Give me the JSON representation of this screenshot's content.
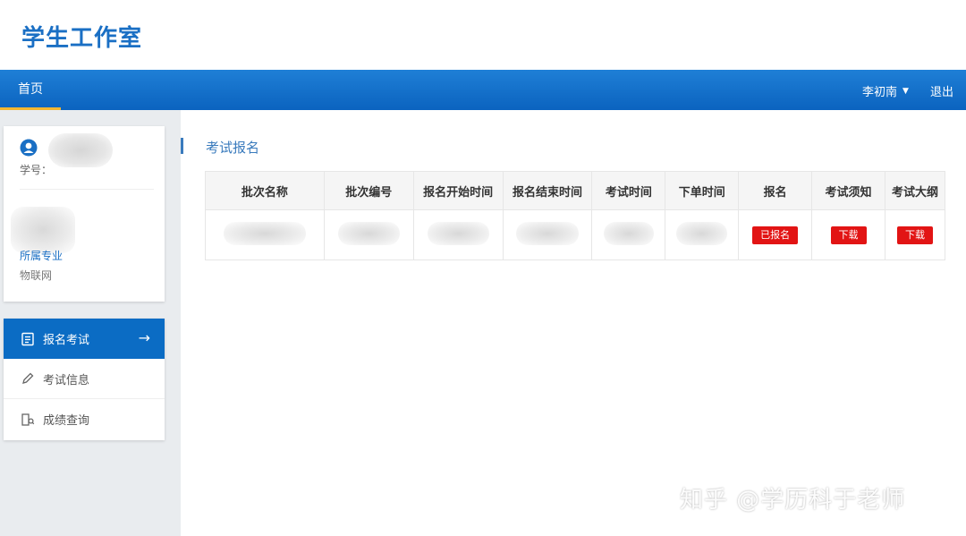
{
  "header": {
    "brand": "学生工作室"
  },
  "nav": {
    "home": "首页",
    "user": "李初南",
    "logout": "退出"
  },
  "profile": {
    "student_no_label": "学号：",
    "major_label": "所属专业",
    "major_value": "物联网"
  },
  "menu": {
    "items": [
      {
        "label": "报名考试",
        "icon": "register-exam-icon"
      },
      {
        "label": "考试信息",
        "icon": "pencil-icon"
      },
      {
        "label": "成绩查询",
        "icon": "score-query-icon"
      }
    ]
  },
  "section": {
    "title": "考试报名"
  },
  "table": {
    "headers": [
      "批次名称",
      "批次编号",
      "报名开始时间",
      "报名结束时间",
      "考试时间",
      "下单时间",
      "报名",
      "考试须知",
      "考试大纲"
    ],
    "row": {
      "register": "已报名",
      "notice": "下载",
      "outline": "下载"
    }
  },
  "watermark": "知乎 @学历科于老师",
  "colors": {
    "primary": "#0b6cc4",
    "danger": "#e21414",
    "accent": "#f2b632"
  }
}
